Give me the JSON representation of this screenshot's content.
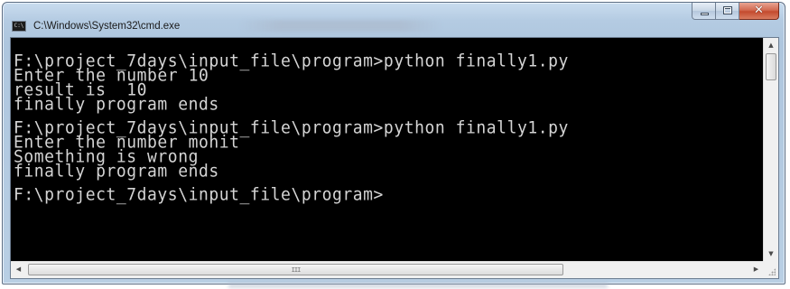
{
  "window": {
    "title": "C:\\Windows\\System32\\cmd.exe",
    "icon": "cmd-icon",
    "icon_text": "C:\\",
    "caption_buttons": {
      "minimize": "minimize-icon",
      "maximize": "maximize-icon",
      "close": "close-icon",
      "close_glyph": "✕"
    }
  },
  "console": {
    "lines": [
      "F:\\project_7days\\input_file\\program>python finally1.py",
      "Enter the number 10",
      "result is  10",
      "finally program ends",
      "",
      "F:\\project_7days\\input_file\\program>python finally1.py",
      "Enter the number mohit",
      "Something is wrong",
      "finally program ends",
      "",
      "F:\\project_7days\\input_file\\program>"
    ],
    "text_color": "#d4d4d4",
    "background_color": "#000000"
  },
  "scrollbars": {
    "vertical": {
      "up_arrow": "▲",
      "down_arrow": "▼"
    },
    "horizontal": {
      "left_arrow": "◀",
      "right_arrow": "▶",
      "grip": "III"
    }
  },
  "colors": {
    "title_close_button": "#c44a2e",
    "window_frame": "#b4cbe2"
  }
}
